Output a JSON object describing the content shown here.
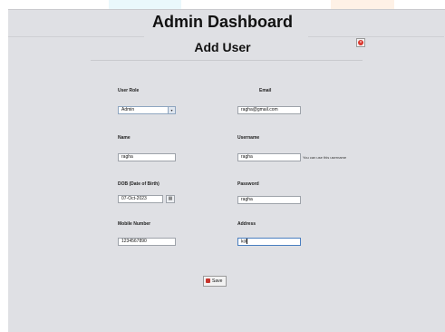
{
  "header": {
    "title": "Admin Dashboard",
    "subtitle": "Add User"
  },
  "form": {
    "user_role": {
      "label": "User Role",
      "value": "Admin"
    },
    "email": {
      "label": "Email",
      "value": "ragha@gmail.com"
    },
    "name": {
      "label": "Name",
      "value": "ragha"
    },
    "username": {
      "label": "Username",
      "value": "ragha",
      "hint": "You can use this username"
    },
    "dob": {
      "label": "DOB (Date of Birth)",
      "value": "07-Oct-2023"
    },
    "password": {
      "label": "Password",
      "value": "ragha"
    },
    "mobile": {
      "label": "Mobile Number",
      "value": "1234567890"
    },
    "address": {
      "label": "Address",
      "value": "kol"
    }
  },
  "actions": {
    "save_label": "Save"
  },
  "icons": {
    "close": "close-icon",
    "save": "floppy-disk-icon",
    "calendar": "calendar-icon",
    "dropdown": "chevron-down-icon"
  },
  "colors": {
    "window_bg": "#dfe0e4",
    "close_red": "#d9342b",
    "save_red": "#c6352d",
    "accent_cyan": "#d8f3f9",
    "accent_orange": "#fde6d2"
  }
}
